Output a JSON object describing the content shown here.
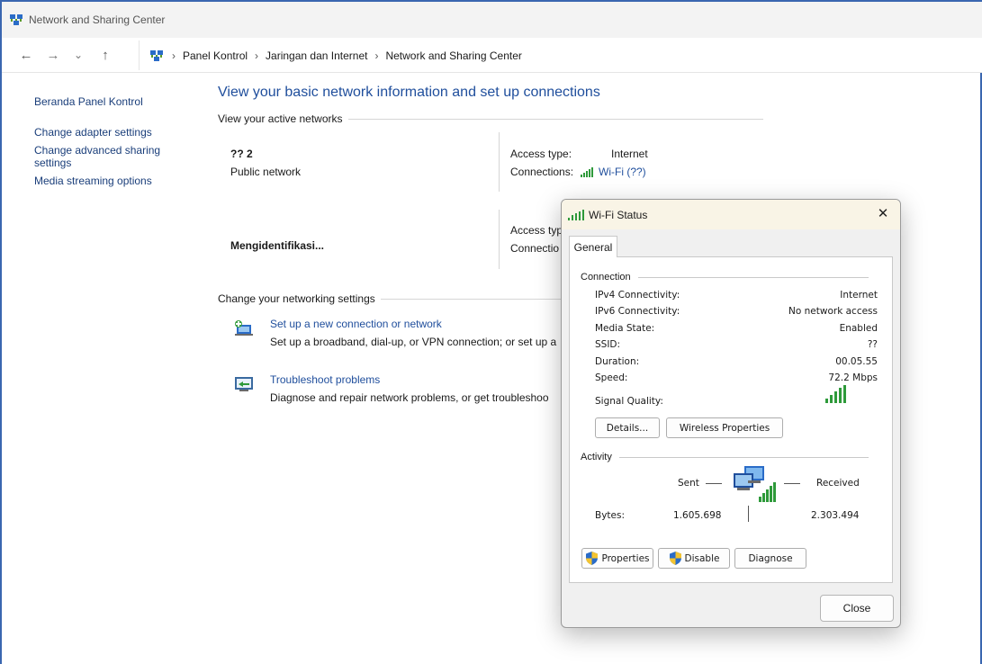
{
  "window": {
    "title": "Network and Sharing Center"
  },
  "breadcrumb": [
    "Panel Kontrol",
    "Jaringan dan Internet",
    "Network and Sharing Center"
  ],
  "nav": {
    "back": "←",
    "forward": "→",
    "recent": "⌄",
    "up": "↑",
    "sep": "›"
  },
  "sidebar": {
    "items": [
      {
        "label": "Beranda Panel Kontrol"
      },
      {
        "label": "Change adapter settings"
      },
      {
        "label": "Change advanced sharing settings"
      },
      {
        "label": "Media streaming options"
      }
    ]
  },
  "main": {
    "title": "View your basic network information and set up connections",
    "active_header": "View your active networks",
    "networks": [
      {
        "name": "?? 2",
        "type": "Public network",
        "access_label": "Access type:",
        "access_value": "Internet",
        "conn_label": "Connections:",
        "conn_value": "Wi-Fi (??)"
      },
      {
        "name": "Mengidentifikasi...",
        "access_label": "Access typ",
        "conn_label": "Connectio"
      }
    ],
    "settings_header": "Change your networking settings",
    "tasks": [
      {
        "link": "Set up a new connection or network",
        "desc": "Set up a broadband, dial-up, or VPN connection; or set up a"
      },
      {
        "link": "Troubleshoot problems",
        "desc": "Diagnose and repair network problems, or get troubleshoo"
      }
    ]
  },
  "dialog": {
    "title": "Wi-Fi Status",
    "close_glyph": "✕",
    "tab": "General",
    "connection_header": "Connection",
    "rows": [
      {
        "label": "IPv4 Connectivity:",
        "value": "Internet"
      },
      {
        "label": "IPv6 Connectivity:",
        "value": "No network access"
      },
      {
        "label": "Media State:",
        "value": "Enabled"
      },
      {
        "label": "SSID:",
        "value": "??"
      },
      {
        "label": "Duration:",
        "value": "00.05.55"
      },
      {
        "label": "Speed:",
        "value": "72.2 Mbps"
      }
    ],
    "signal_label": "Signal Quality:",
    "signal_bars": 5,
    "details_btn": "Details...",
    "wireless_btn": "Wireless Properties",
    "activity_header": "Activity",
    "sent_label": "Sent",
    "received_label": "Received",
    "bytes_label": "Bytes:",
    "bytes_sent": "1.605.698",
    "bytes_received": "2.303.494",
    "properties_btn": "Properties",
    "disable_btn": "Disable",
    "diagnose_btn": "Diagnose",
    "close_btn": "Close"
  },
  "colors": {
    "link": "#1f4e9c",
    "signal": "#2e9a3a",
    "frame": "#3a66b0"
  }
}
